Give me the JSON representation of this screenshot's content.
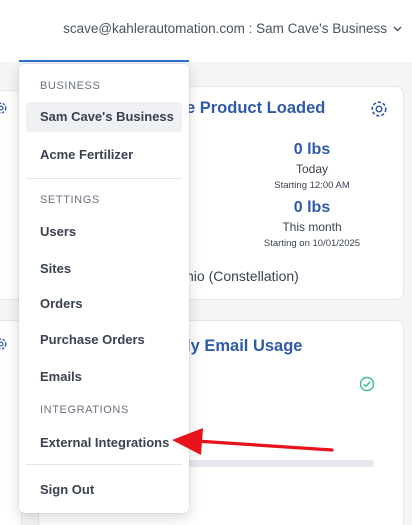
{
  "header": {
    "account_label": "scave@kahlerautomation.com : Sam Cave's Business",
    "chevron_icon": "chevron-down-icon"
  },
  "background": {
    "card1": {
      "title": "e Product Loaded",
      "today_value": "0 lbs",
      "today_label": "Today",
      "today_since": "Starting 12:00 AM",
      "month_value": "0 lbs",
      "month_label": "This month",
      "month_since": "Starting on 10/01/2025",
      "site_text": "nio (Constellation)"
    },
    "card2": {
      "title": "ly Email Usage"
    }
  },
  "menu": {
    "business_header": "BUSINESS",
    "business_items": [
      "Sam Cave's Business",
      "Acme Fertilizer"
    ],
    "settings_header": "SETTINGS",
    "settings_items": [
      "Users",
      "Sites",
      "Orders",
      "Purchase Orders",
      "Emails"
    ],
    "integrations_header": "INTEGRATIONS",
    "integrations_items": [
      "External Integrations"
    ],
    "sign_out": "Sign Out"
  },
  "colors": {
    "accent": "#2f5aa8",
    "annotation": "#e8121b",
    "check": "#3bbf8a"
  }
}
